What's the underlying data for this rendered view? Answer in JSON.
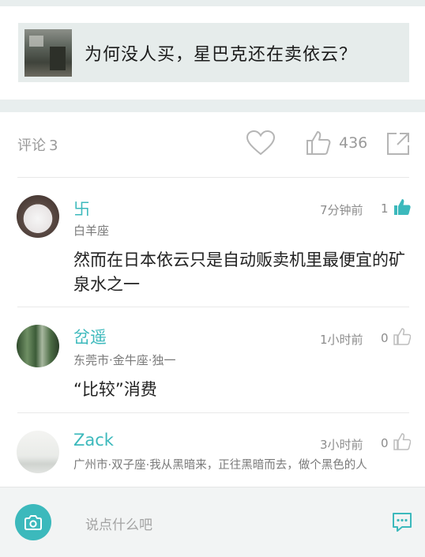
{
  "related": {
    "title": "为何没人买，星巴克还在卖依云？"
  },
  "stats": {
    "comments_label": "评论",
    "comments_count": "3",
    "likes_count": "436"
  },
  "comments": [
    {
      "name": "卐",
      "meta": "白羊座",
      "time": "7分钟前",
      "likes": "1",
      "liked": true,
      "text": "然而在日本依云只是自动贩卖机里最便宜的矿泉水之一"
    },
    {
      "name": "岔遥",
      "meta": "东莞市·金牛座·独一",
      "time": "1小时前",
      "likes": "0",
      "liked": false,
      "text": "“比较”消费"
    },
    {
      "name": "Zack",
      "meta": "广州市·双子座·我从黑暗来，正往黑暗而去，做个黑色的人",
      "time": "3小时前",
      "likes": "0",
      "liked": false,
      "text": ""
    }
  ],
  "composer": {
    "placeholder": "说点什么吧"
  },
  "colors": {
    "accent": "#3cb9bc",
    "muted": "#9a9a9a",
    "band": "#e8eeee"
  },
  "icons": {
    "heart": "heart-icon",
    "like": "thumbs-up-icon",
    "share": "share-icon",
    "camera": "camera-icon",
    "chat": "chat-icon"
  }
}
